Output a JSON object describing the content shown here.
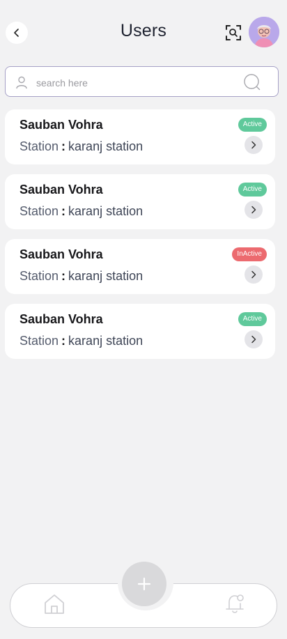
{
  "header": {
    "title": "Users",
    "back_icon": "chevron-left-icon",
    "scan_icon": "scan-icon"
  },
  "search": {
    "placeholder": "search here",
    "value": ""
  },
  "users": [
    {
      "name": "Sauban Vohra",
      "station_label": "Station",
      "separator": ":",
      "station": "karanj station",
      "status": "Active"
    },
    {
      "name": "Sauban Vohra",
      "station_label": "Station",
      "separator": ":",
      "station": "karanj station",
      "status": "Active"
    },
    {
      "name": "Sauban Vohra",
      "station_label": "Station",
      "separator": ":",
      "station": "karanj station",
      "status": "InActive"
    },
    {
      "name": "Sauban Vohra",
      "station_label": "Station",
      "separator": ":",
      "station": "karanj station",
      "status": "Active"
    }
  ],
  "colors": {
    "active": "#5fc99b",
    "inactive": "#ec6a6f",
    "background": "#f2f2f3"
  },
  "bottom_nav": {
    "items": [
      "home-icon",
      "plus-icon",
      "bell-icon"
    ]
  }
}
